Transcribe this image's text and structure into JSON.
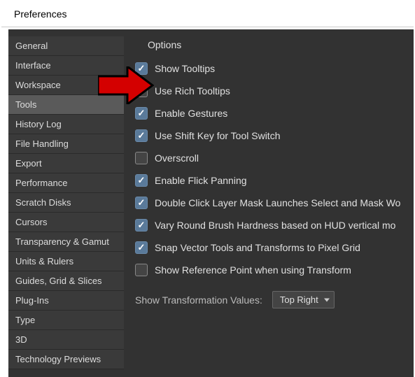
{
  "title": "Preferences",
  "sidebar": {
    "items": [
      {
        "label": "General"
      },
      {
        "label": "Interface"
      },
      {
        "label": "Workspace"
      },
      {
        "label": "Tools"
      },
      {
        "label": "History Log"
      },
      {
        "label": "File Handling"
      },
      {
        "label": "Export"
      },
      {
        "label": "Performance"
      },
      {
        "label": "Scratch Disks"
      },
      {
        "label": "Cursors"
      },
      {
        "label": "Transparency & Gamut"
      },
      {
        "label": "Units & Rulers"
      },
      {
        "label": "Guides, Grid & Slices"
      },
      {
        "label": "Plug-Ins"
      },
      {
        "label": "Type"
      },
      {
        "label": "3D"
      },
      {
        "label": "Technology Previews"
      }
    ],
    "activeIndex": 3
  },
  "options": {
    "title": "Options",
    "items": [
      {
        "label": "Show Tooltips",
        "checked": true
      },
      {
        "label": "Use Rich Tooltips",
        "checked": false
      },
      {
        "label": "Enable Gestures",
        "checked": true
      },
      {
        "label": "Use Shift Key for Tool Switch",
        "checked": true
      },
      {
        "label": "Overscroll",
        "checked": false
      },
      {
        "label": "Enable Flick Panning",
        "checked": true
      },
      {
        "label": "Double Click Layer Mask Launches Select and Mask Wo",
        "checked": true
      },
      {
        "label": "Vary Round Brush Hardness based on HUD vertical mo",
        "checked": true
      },
      {
        "label": "Snap Vector Tools and Transforms to Pixel Grid",
        "checked": true
      },
      {
        "label": "Show Reference Point when using Transform",
        "checked": false
      }
    ],
    "transformLabel": "Show Transformation Values:",
    "transformValue": "Top Right"
  }
}
